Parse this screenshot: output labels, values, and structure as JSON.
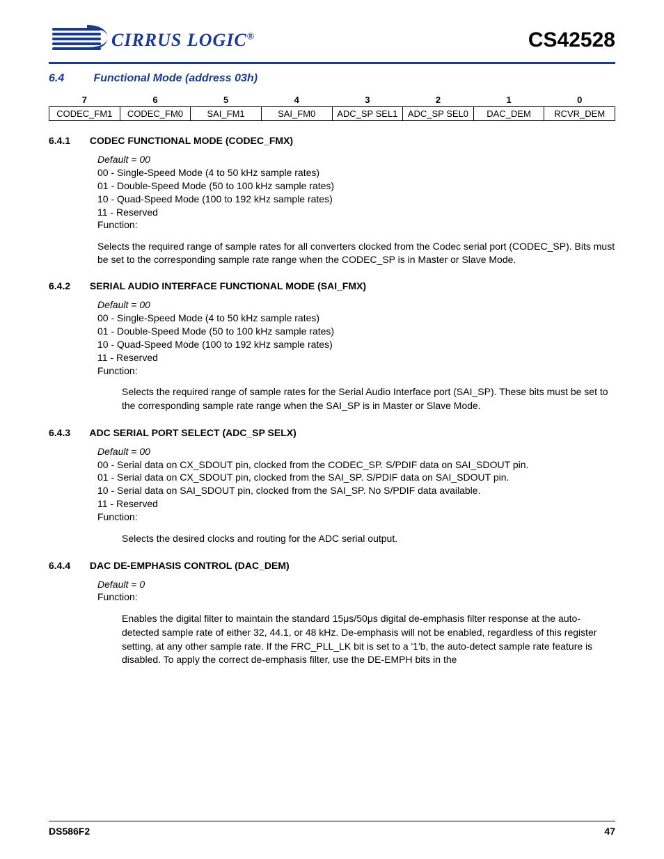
{
  "header": {
    "logo_text": "CIRRUS LOGIC",
    "logo_reg": "®",
    "doc_title": "CS42528"
  },
  "section": {
    "num": "6.4",
    "title": "Functional Mode (address 03h)"
  },
  "reg_bits": {
    "nums": [
      "7",
      "6",
      "5",
      "4",
      "3",
      "2",
      "1",
      "0"
    ],
    "names": [
      "CODEC_FM1",
      "CODEC_FM0",
      "SAI_FM1",
      "SAI_FM0",
      "ADC_SP SEL1",
      "ADC_SP SEL0",
      "DAC_DEM",
      "RCVR_DEM"
    ]
  },
  "s1": {
    "num": "6.4.1",
    "title": "CODEC FUNCTIONAL MODE (CODEC_FMX)",
    "default": "Default = 00",
    "l0": "00 - Single-Speed Mode (4 to 50 kHz sample rates)",
    "l1": "01 - Double-Speed Mode (50 to 100 kHz sample rates)",
    "l2": "10 - Quad-Speed Mode (100 to 192 kHz sample rates)",
    "l3": "11 - Reserved",
    "func": "Function:",
    "body": "Selects the required range of sample rates for all converters clocked from the Codec serial port (CODEC_SP). Bits must be set to the corresponding sample rate range when the CODEC_SP is in Master or Slave Mode."
  },
  "s2": {
    "num": "6.4.2",
    "title": "SERIAL AUDIO INTERFACE FUNCTIONAL MODE (SAI_FMX)",
    "default": "Default = 00",
    "l0": "00 - Single-Speed Mode (4 to 50 kHz sample rates)",
    "l1": "01 - Double-Speed Mode (50 to 100 kHz sample rates)",
    "l2": "10 - Quad-Speed Mode (100 to 192 kHz sample rates)",
    "l3": "11 - Reserved",
    "func": "Function:",
    "body": "Selects the required range of sample rates for the Serial Audio Interface port (SAI_SP). These bits must be set to the corresponding sample rate range when the SAI_SP is in Master or Slave Mode."
  },
  "s3": {
    "num": "6.4.3",
    "title": "ADC SERIAL PORT SELECT (ADC_SP SELX)",
    "default": "Default = 00",
    "l0": "00 - Serial data on CX_SDOUT pin, clocked from the CODEC_SP. S/PDIF data on SAI_SDOUT pin.",
    "l1": "01 - Serial data on CX_SDOUT pin, clocked from the SAI_SP. S/PDIF data on SAI_SDOUT pin.",
    "l2": "10 - Serial data on SAI_SDOUT pin, clocked from the SAI_SP. No S/PDIF data available.",
    "l3": "11 - Reserved",
    "func": "Function:",
    "body": "Selects the desired clocks and routing for the ADC serial output."
  },
  "s4": {
    "num": "6.4.4",
    "title": "DAC DE-EMPHASIS CONTROL (DAC_DEM)",
    "default": "Default = 0",
    "func": "Function:",
    "body": "Enables the digital filter to maintain the standard 15μs/50μs digital de-emphasis filter response at the auto-detected sample rate of either 32, 44.1, or 48 kHz. De-emphasis will not be enabled, regardless of this register setting, at any other sample rate. If the FRC_PLL_LK bit is set to a '1'b, the auto-detect sample rate feature is disabled. To apply the correct de-emphasis filter, use the DE-EMPH bits in the"
  },
  "footer": {
    "left": "DS586F2",
    "right": "47"
  }
}
